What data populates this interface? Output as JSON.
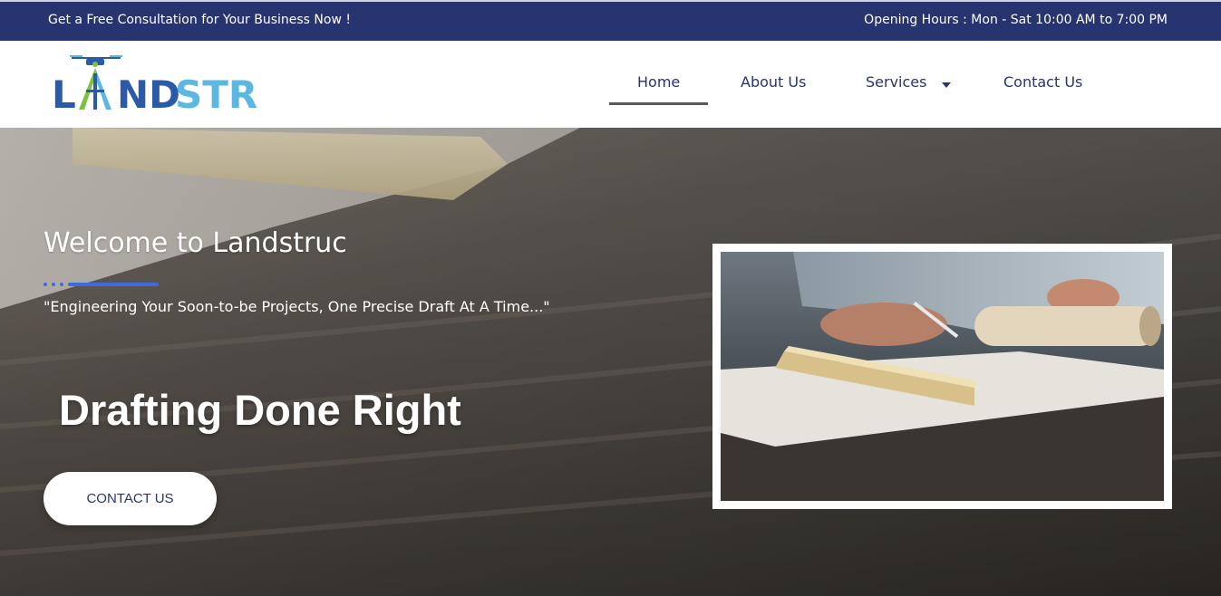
{
  "topbar": {
    "left_text": "Get a Free Consultation for Your Business Now !",
    "right_text": "Opening Hours : Mon - Sat 10:00 AM to 7:00 PM"
  },
  "logo": {
    "text": "LANDSTRUC",
    "colors": {
      "dark_blue": "#2b5aa8",
      "light_blue": "#5cb8e0",
      "green": "#7cc242"
    }
  },
  "nav": {
    "items": [
      {
        "label": "Home",
        "active": true
      },
      {
        "label": "About Us",
        "active": false
      },
      {
        "label": "Services",
        "active": false,
        "has_dropdown": true
      },
      {
        "label": "Contact Us",
        "active": false
      }
    ]
  },
  "hero": {
    "welcome": "Welcome to Landstruc",
    "tagline": "\"Engineering Your Soon-to-be Projects, One Precise Draft At A Time...\"",
    "headline": "Drafting Done Right",
    "cta_label": "CONTACT US"
  },
  "colors": {
    "brand_navy": "#283470",
    "accent_blue": "#3b6ce0",
    "white": "#ffffff"
  }
}
